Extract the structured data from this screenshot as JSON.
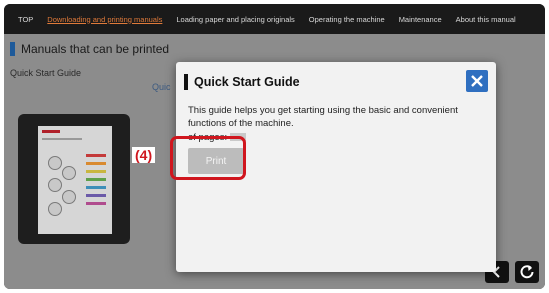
{
  "topnav": {
    "items": [
      {
        "label": "TOP"
      },
      {
        "label": "Downloading and printing manuals",
        "active": true
      },
      {
        "label": "Loading paper and placing originals"
      },
      {
        "label": "Operating the machine"
      },
      {
        "label": "Maintenance"
      },
      {
        "label": "About this manual"
      }
    ]
  },
  "page": {
    "title": "Manuals that can be printed",
    "guide_label": "Quick Start Guide",
    "partial_label": "Quic"
  },
  "dialog": {
    "title": "Quick Start Guide",
    "description": "This guide helps you get starting using the basic and convenient functions of the machine.",
    "pages_label": "of pages:",
    "print_label": "Print"
  },
  "annotation": {
    "step": "(4)"
  },
  "colors": {
    "accent_blue": "#2f6fc0",
    "highlight_red": "#d0161e",
    "active_nav": "#e07a3a"
  },
  "icons": [
    "close-icon",
    "back-icon",
    "refresh-icon"
  ]
}
